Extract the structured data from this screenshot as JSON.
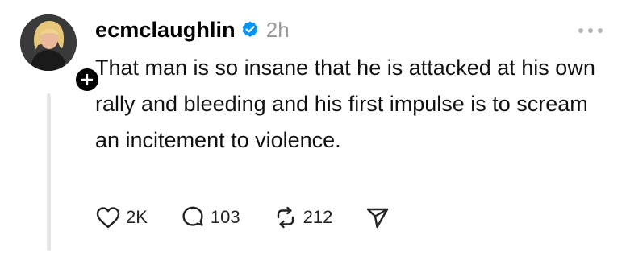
{
  "post": {
    "username": "ecmclaughlin",
    "timestamp": "2h",
    "text": "That man is so insane that he is attacked at his own rally and bleeding and his first impulse is to scream an incitement to violence.",
    "verified": true
  },
  "actions": {
    "likes": "2K",
    "replies": "103",
    "reposts": "212"
  },
  "icons": {
    "verified": "verified-badge-icon",
    "follow": "plus-icon",
    "more": "more-horizontal-icon",
    "like": "heart-icon",
    "reply": "comment-bubble-icon",
    "repost": "repost-icon",
    "share": "send-icon"
  },
  "colors": {
    "verified_blue": "#0095f6",
    "muted_text": "#9b9b9b",
    "thread_line": "#e4e4e4"
  }
}
